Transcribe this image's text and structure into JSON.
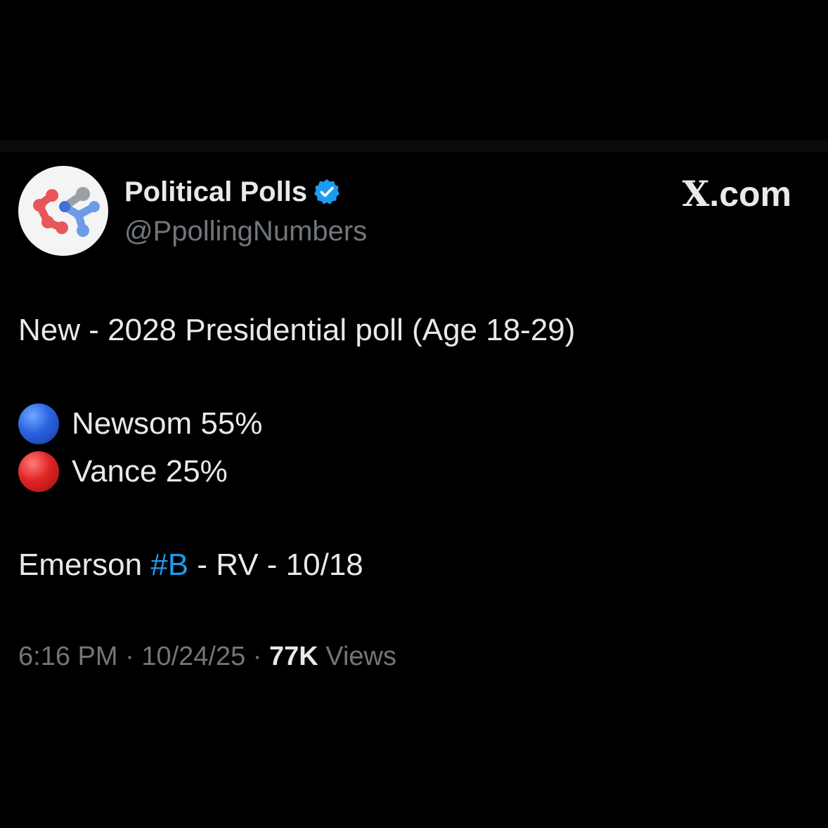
{
  "post": {
    "display_name": "Political Polls",
    "handle": "@PpollingNumbers",
    "brand": "X.com",
    "brand_glyph": "X",
    "brand_suffix": ".com",
    "headline": "New - 2028 Presidential poll (Age 18-29)",
    "results": [
      {
        "candidate": "Newsom 55%",
        "color": "#2a62e0",
        "icon": "blue-circle-icon"
      },
      {
        "candidate": "Vance 25%",
        "color": "#e02424",
        "icon": "red-circle-icon"
      }
    ],
    "source": {
      "pollster": "Emerson ",
      "hashtag": "#B",
      "rest": " - RV - 10/18"
    },
    "meta": {
      "time": "6:16 PM",
      "sep1": " · ",
      "date": "10/24/25",
      "sep2": " · ",
      "views_count": "77K",
      "views_label": " Views"
    }
  },
  "colors": {
    "background": "#000000",
    "text": "#e7e9ea",
    "muted": "#71767b",
    "link": "#1d9bf0",
    "verified": "#1d9bf0"
  }
}
